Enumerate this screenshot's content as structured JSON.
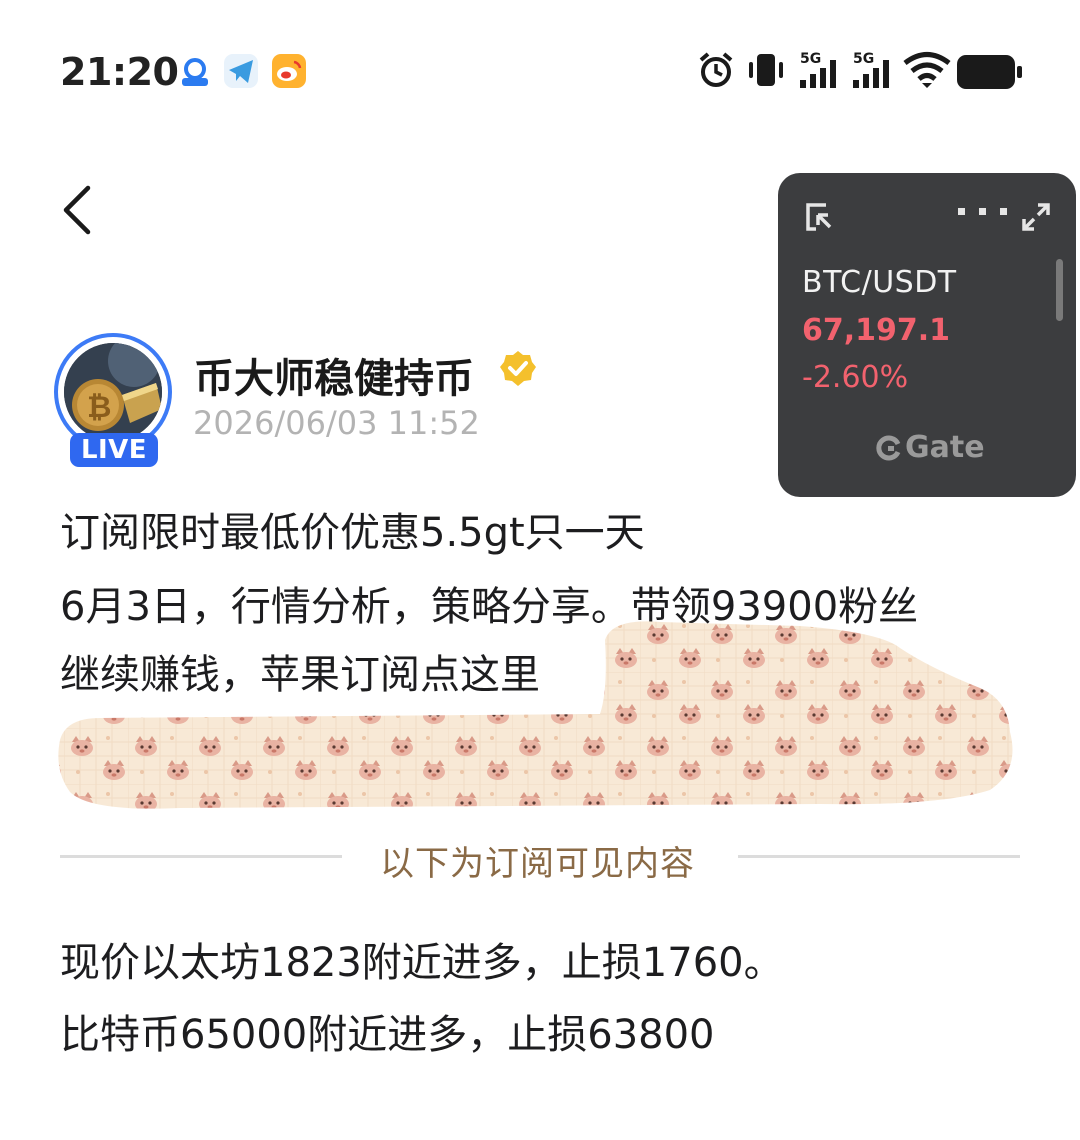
{
  "status_bar": {
    "time": "21:20",
    "apps": [
      "browser-app-icon",
      "telegram-icon",
      "weibo-icon"
    ],
    "network_1": "5G",
    "network_2": "5G"
  },
  "nav": {
    "back_icon": "chevron-left-icon"
  },
  "ticker_widget": {
    "pair": "BTC/USDT",
    "price": "67,197.1",
    "change": "-2.60%",
    "brand": "Gate",
    "colors": {
      "background": "#3c3d3f",
      "down": "#f2626e"
    }
  },
  "author": {
    "name": "币大师稳健持币",
    "live_label": "LIVE",
    "time": "2026/06/03 11:52",
    "verified_color": "#f4c02c"
  },
  "post": {
    "line_1": "订阅限时最低价优惠5.5gt只一天",
    "line_2": "6月3日，行情分析，策略分享。带领93900粉丝",
    "line_3": "继续赚钱，苹果订阅点这里",
    "subscriber_divider": "以下为订阅可见内容",
    "paid_line_1": "现价以太坊1823附近进多，止损1760。",
    "paid_line_2": "比特币65000附近进多，止损63800"
  }
}
